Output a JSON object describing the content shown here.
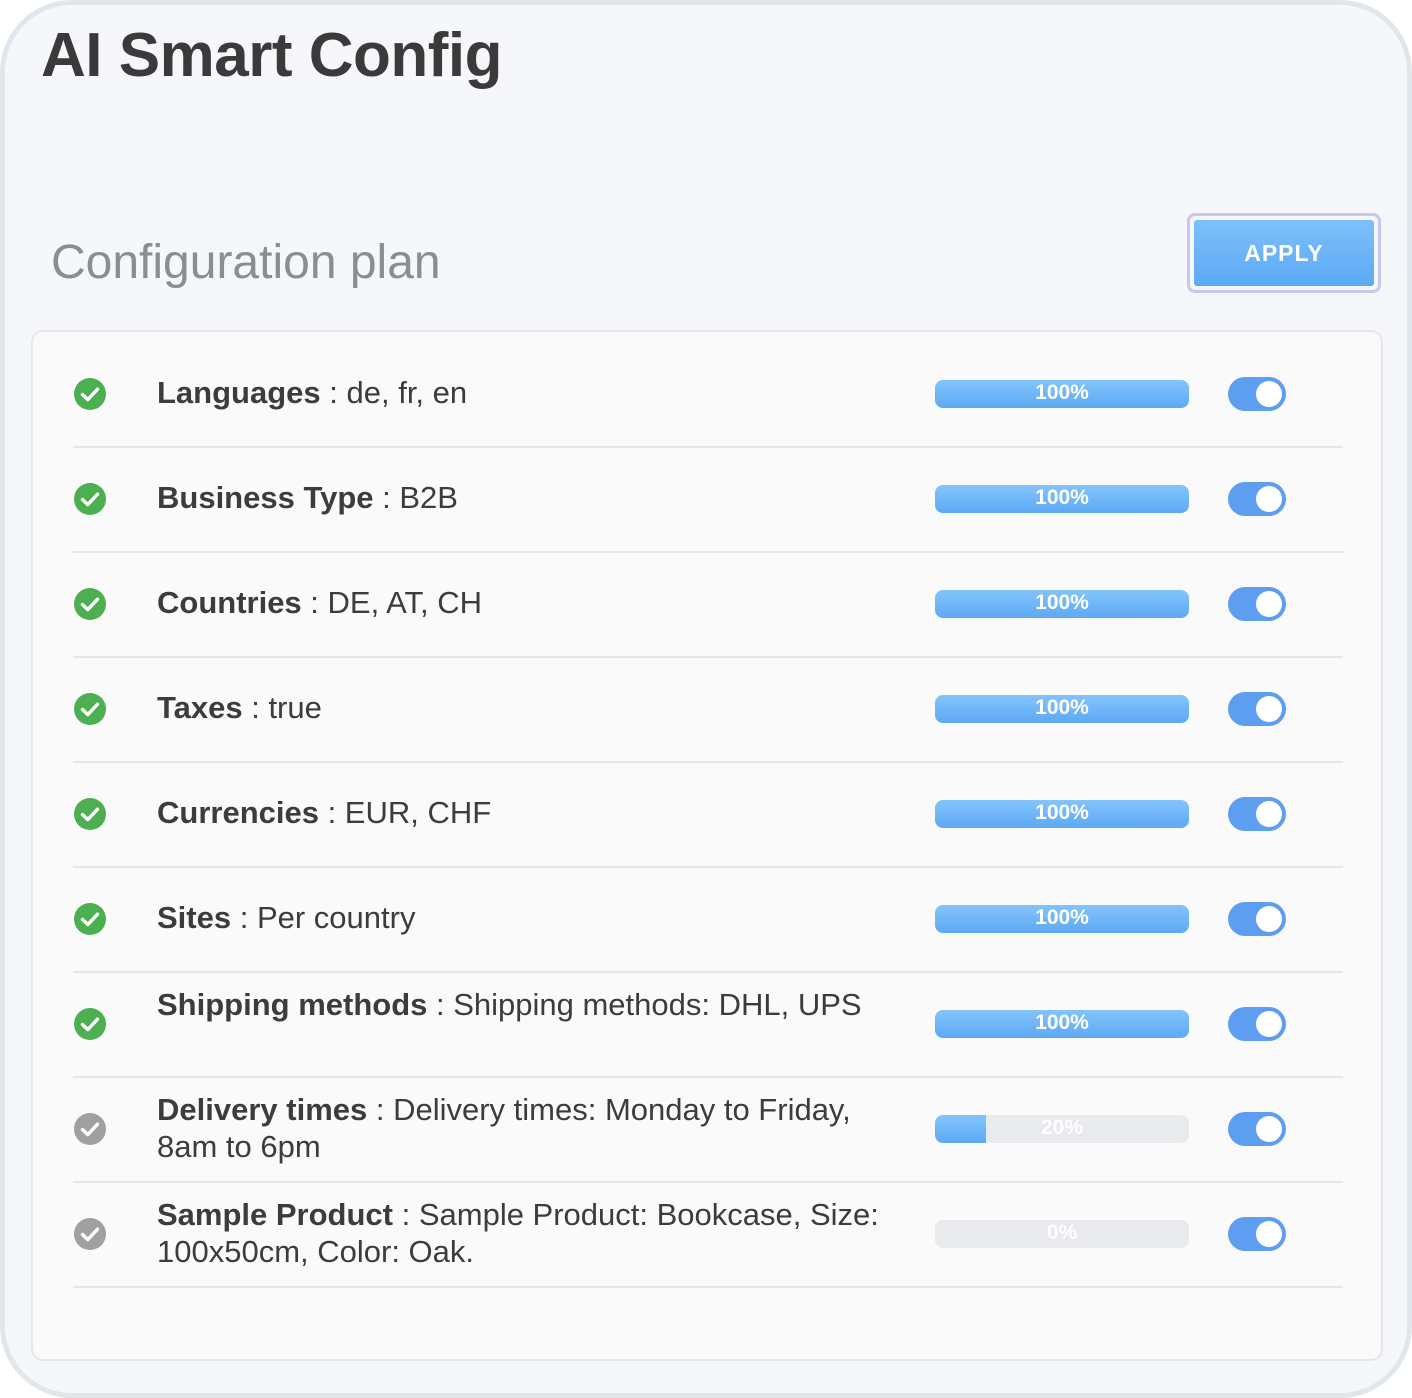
{
  "app": {
    "title": "AI Smart Config"
  },
  "plan": {
    "title": "Configuration plan",
    "apply_label": "APPLY"
  },
  "colors": {
    "accent": "#5ea9f4",
    "success": "#4caf50",
    "pending": "#a0a0a0",
    "toggle_on": "#5e9ef0"
  },
  "rows": [
    {
      "key": "Languages",
      "value": " : de, fr, en",
      "progress": 100,
      "progress_label": "100%",
      "status": "done",
      "status_icon": "check-circle-icon",
      "enabled": true
    },
    {
      "key": "Business Type",
      "value": " : B2B",
      "progress": 100,
      "progress_label": "100%",
      "status": "done",
      "status_icon": "check-circle-icon",
      "enabled": true
    },
    {
      "key": "Countries",
      "value": " : DE, AT, CH",
      "progress": 100,
      "progress_label": "100%",
      "status": "done",
      "status_icon": "check-circle-icon",
      "enabled": true
    },
    {
      "key": "Taxes",
      "value": " : true",
      "progress": 100,
      "progress_label": "100%",
      "status": "done",
      "status_icon": "check-circle-icon",
      "enabled": true
    },
    {
      "key": "Currencies",
      "value": " : EUR, CHF",
      "progress": 100,
      "progress_label": "100%",
      "status": "done",
      "status_icon": "check-circle-icon",
      "enabled": true
    },
    {
      "key": "Sites",
      "value": " : Per country",
      "progress": 100,
      "progress_label": "100%",
      "status": "done",
      "status_icon": "check-circle-icon",
      "enabled": true
    },
    {
      "key": "Shipping methods",
      "value": " : Shipping methods: DHL, UPS",
      "progress": 100,
      "progress_label": "100%",
      "status": "done",
      "status_icon": "check-circle-icon",
      "enabled": true
    },
    {
      "key": "Delivery times",
      "value": " : Delivery times: Monday to Friday, 8am to 6pm",
      "progress": 20,
      "progress_label": "20%",
      "status": "pending",
      "status_icon": "check-circle-icon",
      "enabled": true
    },
    {
      "key": "Sample Product",
      "value": " : Sample Product: Bookcase, Size: 100x50cm, Color: Oak.",
      "progress": 0,
      "progress_label": "0%",
      "status": "pending",
      "status_icon": "check-circle-icon",
      "enabled": true
    }
  ]
}
